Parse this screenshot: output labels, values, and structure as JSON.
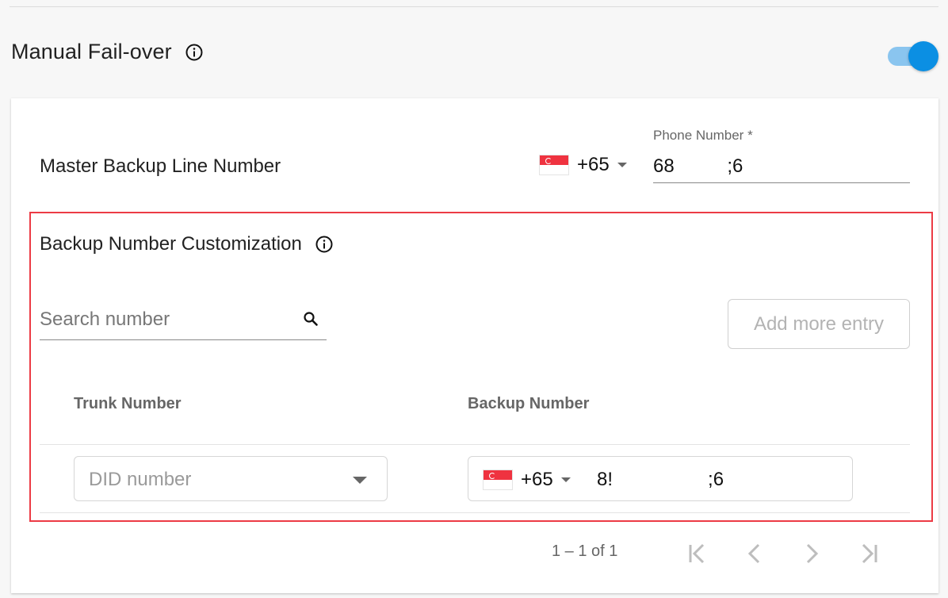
{
  "section": {
    "title": "Manual Fail-over",
    "toggle_on": true
  },
  "master": {
    "label": "Master Backup Line Number",
    "country_code": "+65",
    "phone_label": "Phone Number *",
    "phone_value": "68          ;6"
  },
  "customization": {
    "title": "Backup Number Customization",
    "search_placeholder": "Search number",
    "add_button": "Add more entry",
    "columns": {
      "trunk": "Trunk Number",
      "backup": "Backup Number"
    },
    "rows": [
      {
        "trunk_placeholder": "DID number",
        "backup_country_code": "+65",
        "backup_number": "8!                  ;6"
      }
    ]
  },
  "pagination": {
    "range_text": "1 – 1 of 1"
  },
  "colors": {
    "accent": "#0b8fe3",
    "toggle_track": "#8ac5ef",
    "highlight": "#ec3b45",
    "flag_red": "#ef3340"
  },
  "icons": [
    "info-icon",
    "search-icon",
    "chevron-down-icon",
    "first-page-icon",
    "prev-page-icon",
    "next-page-icon",
    "last-page-icon",
    "singapore-flag-icon"
  ]
}
